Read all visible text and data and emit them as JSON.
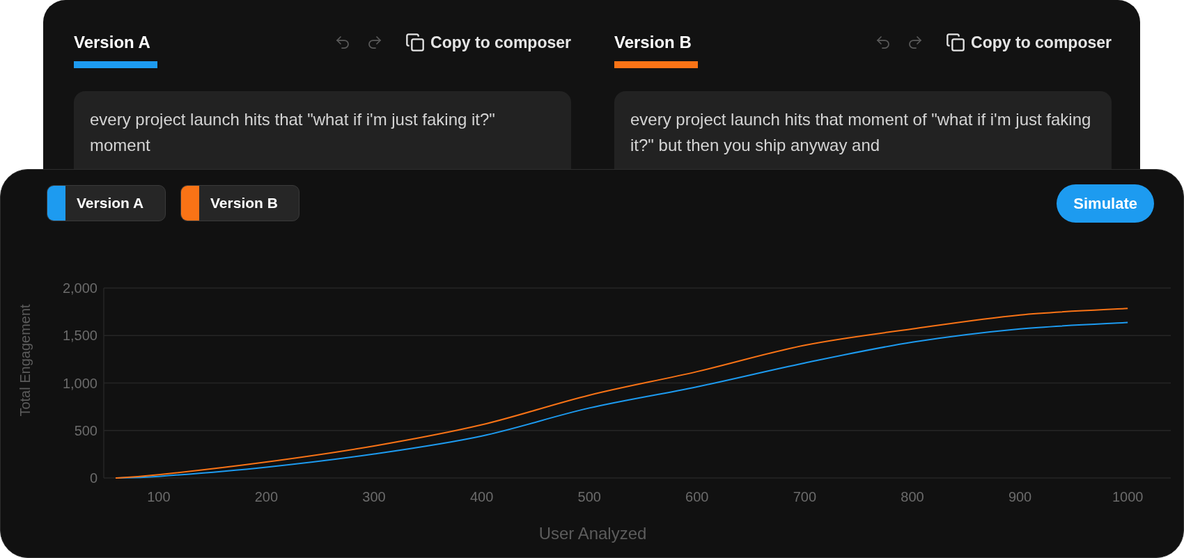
{
  "versions": [
    {
      "title": "Version A",
      "color": "#1d9bf0",
      "copy_label": "Copy to composer",
      "text": "every project launch hits that \"what if i'm just faking it?\" moment"
    },
    {
      "title": "Version B",
      "color": "#f97316",
      "copy_label": "Copy to composer",
      "text": "every project launch hits that moment of \"what if i'm just faking it?\" but then you ship anyway and"
    }
  ],
  "chart_panel": {
    "legend": [
      {
        "label": "Version A",
        "color": "#1d9bf0"
      },
      {
        "label": "Version B",
        "color": "#f97316"
      }
    ],
    "simulate_button": "Simulate",
    "chart_data": {
      "type": "line",
      "xlabel": "User Analyzed",
      "ylabel": "Total Engagement",
      "x": [
        60,
        100,
        200,
        300,
        400,
        500,
        600,
        700,
        800,
        900,
        1000
      ],
      "series": [
        {
          "color": "#1d9bf0",
          "values": [
            0,
            17,
            114,
            253,
            442,
            737,
            960,
            1211,
            1430,
            1570,
            1637
          ]
        },
        {
          "color": "#f97316",
          "values": [
            0,
            34,
            168,
            337,
            560,
            872,
            1120,
            1398,
            1570,
            1717,
            1785
          ]
        }
      ],
      "xlim": [
        49,
        1040
      ],
      "ylim": [
        0,
        2000
      ],
      "grid": true,
      "xticks": [
        100,
        200,
        300,
        400,
        500,
        600,
        700,
        800,
        900,
        1000
      ],
      "yticks": [
        {
          "value": 0,
          "label": "0"
        },
        {
          "value": 500,
          "label": "500"
        },
        {
          "value": 1000,
          "label": "1,000"
        },
        {
          "value": 1500,
          "label": "1,500"
        },
        {
          "value": 2000,
          "label": "2,000"
        }
      ]
    }
  }
}
